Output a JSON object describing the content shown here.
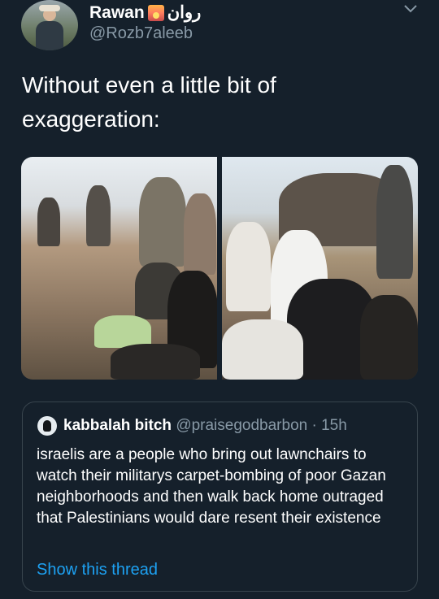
{
  "user": {
    "display_name": "Rawan",
    "display_name_ar": "روان",
    "name_emoji": "sunset-emoji",
    "handle": "@Rozb7aleeb"
  },
  "tweet": {
    "text": "Without even a little bit of exaggeration:"
  },
  "media": {
    "count": 2,
    "left_photo": "crowd-on-hillside-photo",
    "right_photo": "men-on-couch-photo"
  },
  "quote": {
    "name": "kabbalah bitch",
    "handle": "@praisegodbarbon",
    "separator": "·",
    "time": "15h",
    "text": "israelis are a people who bring out lawnchairs to watch their militarys carpet-bombing of poor Gazan neighborhoods and then walk back home outraged that Palestinians would dare resent their existence",
    "show_thread": "Show this thread"
  },
  "colors": {
    "background": "#15202b",
    "text": "#ffffff",
    "secondary": "#8899a6",
    "link": "#1da1f2",
    "border": "#38444d"
  }
}
